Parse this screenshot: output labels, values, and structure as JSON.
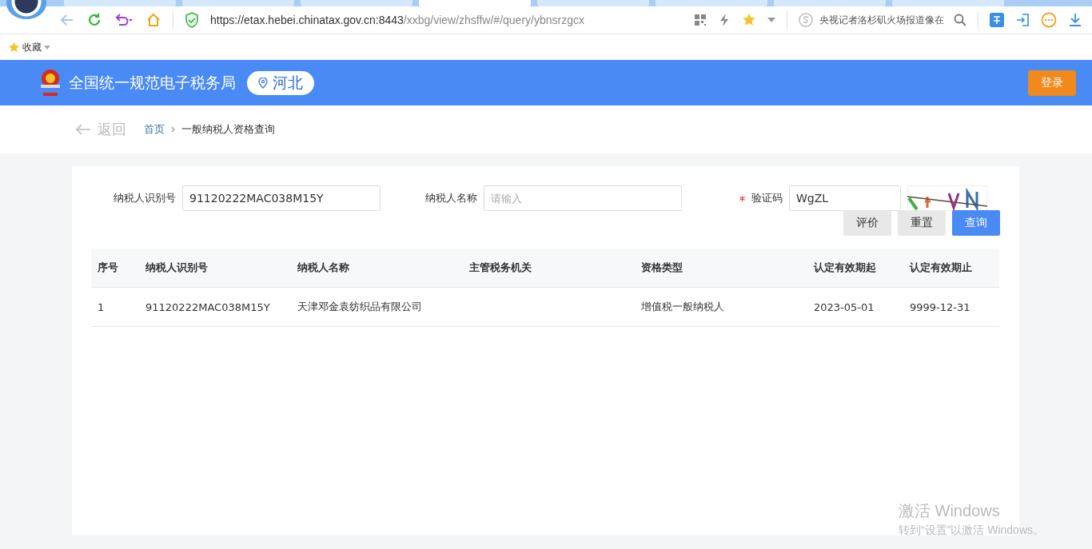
{
  "browser": {
    "url_host": "https://etax.hebei.chinatax.gov.cn:8443",
    "url_path": "/xxbg/view/zhsffw/#/query/ybnsrzgcx",
    "search_text": "央视记者洛杉矶火场报道像在",
    "tabs": [
      {
        "selected": false
      },
      {
        "selected": false
      },
      {
        "selected": false
      },
      {
        "selected": true
      },
      {
        "selected": false
      },
      {
        "selected": false
      },
      {
        "selected": false
      },
      {
        "selected": false
      }
    ]
  },
  "bookmarks": {
    "label": "收藏"
  },
  "header": {
    "title": "全国统一规范电子税务局",
    "region": "河北",
    "login": "登录"
  },
  "breadcrumb": {
    "back": "返回",
    "items": [
      {
        "label": "首页",
        "link": true
      },
      {
        "label": "一般纳税人资格查询",
        "link": false
      }
    ]
  },
  "form": {
    "fields": [
      {
        "label": "纳税人识别号",
        "value": "91120222MAC038M15Y",
        "required": false
      },
      {
        "label": "纳税人名称",
        "placeholder": "请输入",
        "required": false
      },
      {
        "label": "验证码",
        "value": "WgZL",
        "required": true
      }
    ],
    "buttons": [
      {
        "label": "评价",
        "primary": false
      },
      {
        "label": "重置",
        "primary": false
      },
      {
        "label": "查询",
        "primary": true
      }
    ]
  },
  "table": {
    "columns": [
      "序号",
      "纳税人识别号",
      "纳税人名称",
      "主管税务机关",
      "资格类型",
      "认定有效期起",
      "认定有效期止"
    ],
    "rows": [
      [
        "1",
        "91120222MAC038M15Y",
        "天津邓金袁纺织品有限公司",
        "",
        "增值税一般纳税人",
        "2023-05-01",
        "9999-12-31"
      ]
    ]
  },
  "activation": {
    "title": "激活 Windows",
    "text": "转到“设置”以激活 Windows。"
  }
}
